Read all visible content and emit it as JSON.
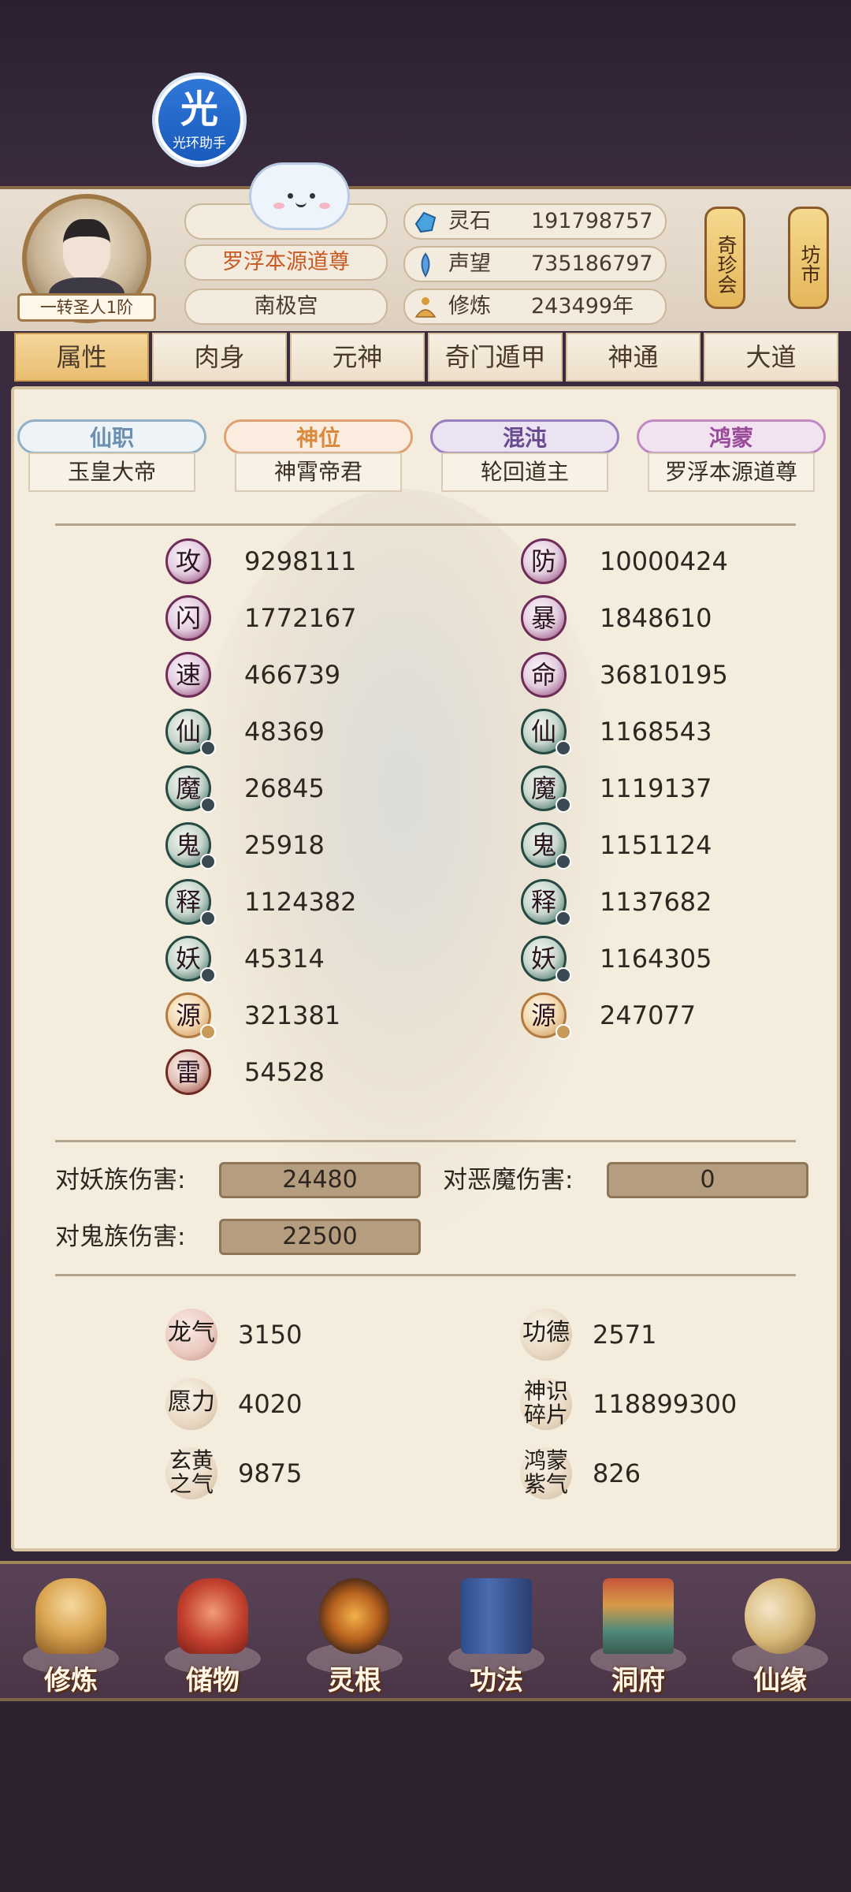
{
  "helper": {
    "char": "光",
    "label": "光环助手"
  },
  "player": {
    "rank": "一转圣人1阶",
    "title": "罗浮本源道尊",
    "sect": "南极宫"
  },
  "resources": [
    {
      "icon": "spirit-stone-icon",
      "label": "灵石",
      "value": "191798757"
    },
    {
      "icon": "fame-icon",
      "label": "声望",
      "value": "735186797"
    },
    {
      "icon": "cultivation-icon",
      "label": "修炼",
      "value": "243499年"
    }
  ],
  "side_buttons": {
    "treasure": "奇珍会",
    "market": "坊市"
  },
  "tabs": [
    "属性",
    "肉身",
    "元神",
    "奇门遁甲",
    "神通",
    "大道"
  ],
  "ranks": [
    {
      "head": "仙职",
      "sub": "玉皇大帝"
    },
    {
      "head": "神位",
      "sub": "神霄帝君"
    },
    {
      "head": "混沌",
      "sub": "轮回道主"
    },
    {
      "head": "鸿蒙",
      "sub": "罗浮本源道尊"
    }
  ],
  "stats_left": [
    {
      "label": "攻",
      "value": "9298111"
    },
    {
      "label": "闪",
      "value": "1772167"
    },
    {
      "label": "速",
      "value": "466739"
    },
    {
      "label": "仙",
      "value": "48369"
    },
    {
      "label": "魔",
      "value": "26845"
    },
    {
      "label": "鬼",
      "value": "25918"
    },
    {
      "label": "释",
      "value": "1124382"
    },
    {
      "label": "妖",
      "value": "45314"
    },
    {
      "label": "源",
      "value": "321381"
    },
    {
      "label": "雷",
      "value": "54528"
    }
  ],
  "stats_right": [
    {
      "label": "防",
      "value": "10000424"
    },
    {
      "label": "暴",
      "value": "1848610"
    },
    {
      "label": "命",
      "value": "36810195"
    },
    {
      "label": "仙",
      "value": "1168543"
    },
    {
      "label": "魔",
      "value": "1119137"
    },
    {
      "label": "鬼",
      "value": "1151124"
    },
    {
      "label": "释",
      "value": "1137682"
    },
    {
      "label": "妖",
      "value": "1164305"
    },
    {
      "label": "源",
      "value": "247077"
    }
  ],
  "damage": {
    "demon_race_label": "对妖族伤害:",
    "demon_race_value": "24480",
    "evil_label": "对恶魔伤害:",
    "evil_value": "0",
    "ghost_label": "对鬼族伤害:",
    "ghost_value": "22500"
  },
  "extra_left": [
    {
      "label": "龙气",
      "value": "3150"
    },
    {
      "label": "愿力",
      "value": "4020"
    },
    {
      "label": "玄黄之气",
      "value": "9875"
    }
  ],
  "extra_right": [
    {
      "label": "功德",
      "value": "2571"
    },
    {
      "label": "神识碎片",
      "value": "118899300"
    },
    {
      "label": "鸿蒙紫气",
      "value": "826"
    }
  ],
  "bottom_nav": [
    "修炼",
    "储物",
    "灵根",
    "功法",
    "洞府",
    "仙缘"
  ],
  "colors": {
    "accent_gold": "#e8bd70",
    "title_orange": "#c65a22",
    "rank_blue": "#6b8fb0",
    "rank_orange": "#d98a3e",
    "rank_purple": "#6a4a8e",
    "rank_pink": "#9a4a9a"
  }
}
